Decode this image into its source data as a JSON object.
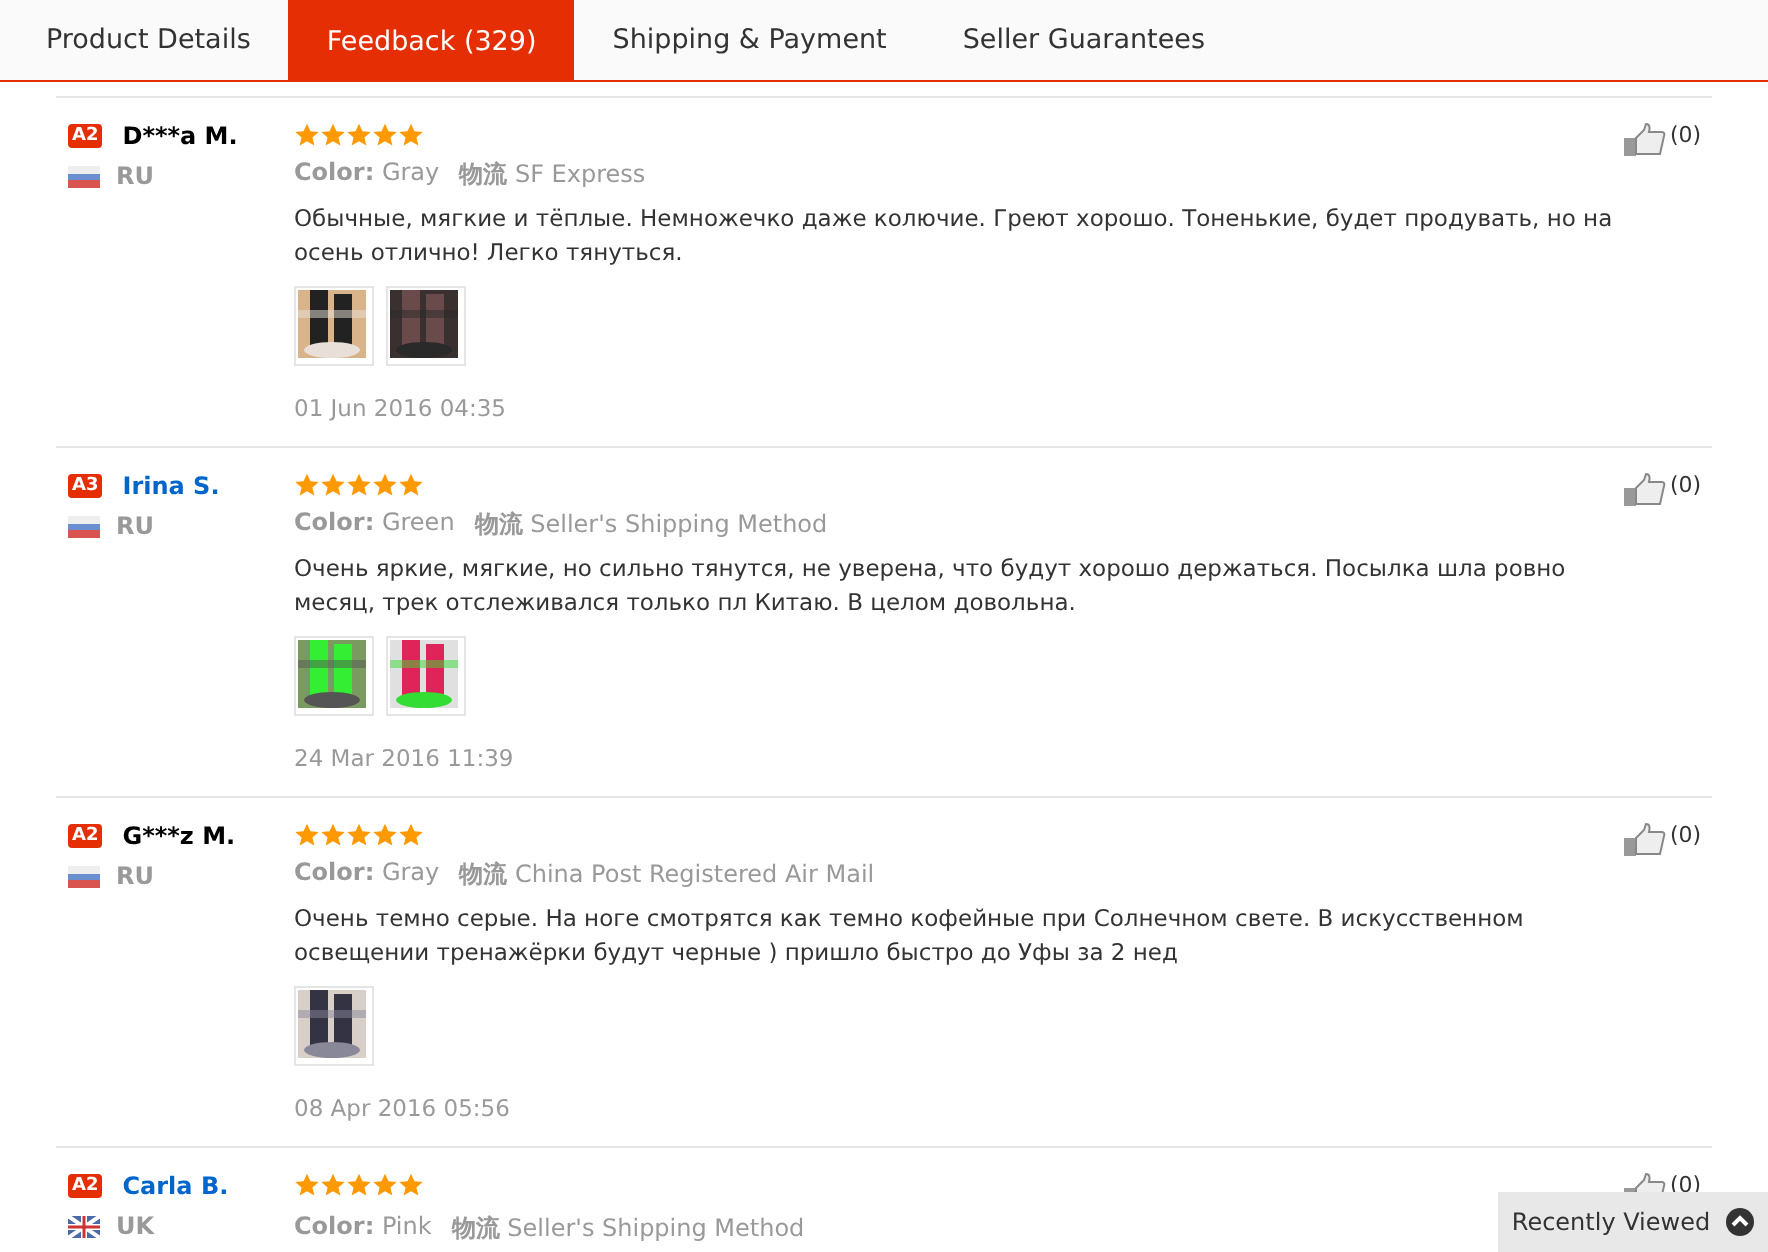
{
  "tabs": [
    {
      "label": "Product Details",
      "selected": false
    },
    {
      "label": "Feedback (329)",
      "selected": true
    },
    {
      "label": "Shipping & Payment",
      "selected": false
    },
    {
      "label": "Seller Guarantees",
      "selected": false
    }
  ],
  "reviews": [
    {
      "level_badge": "A2",
      "name": "D***a M.",
      "highlighted": false,
      "flag": {
        "kind": "tricolor"
      },
      "country": "RU",
      "stars": 5,
      "color_label": "Color:",
      "color_value": "Gray",
      "shipping_label": "物流",
      "shipping_value": "SF Express",
      "text": "Обычные, мягкие и тёплые. Немножечко даже колючие. Греют хорошо. Тоненькие, будет продувать, но на осень отлично! Легко тянуться.",
      "photos": [
        {
          "kind": "picture"
        },
        {
          "kind": "picture"
        }
      ],
      "date": "01 Jun 2016 04:35",
      "likes": "(0)"
    },
    {
      "level_badge": "A3",
      "name": "Irina S.",
      "highlighted": true,
      "flag": {
        "kind": "tricolor"
      },
      "country": "RU",
      "stars": 5,
      "color_label": "Color:",
      "color_value": "Green",
      "shipping_label": "物流",
      "shipping_value": "Seller's Shipping Method",
      "text": "Очень яркие, мягкие, но сильно тянутся, не уверена, что будут хорошо держаться. Посылка шла ровно месяц, трек отслеживался только пл Китаю. В целом довольна.",
      "photos": [
        {
          "kind": "picture"
        },
        {
          "kind": "picture"
        }
      ],
      "date": "24 Mar 2016 11:39",
      "likes": "(0)"
    },
    {
      "level_badge": "A2",
      "name": "G***z M.",
      "highlighted": false,
      "flag": {
        "kind": "tricolor"
      },
      "country": "RU",
      "stars": 5,
      "color_label": "Color:",
      "color_value": "Gray",
      "shipping_label": "物流",
      "shipping_value": "China Post Registered Air Mail",
      "text": "Очень темно серые. На ноге смотрятся как темно кофейные при Солнечном свете. В искусственном освещении тренажёрки будут черные ) пришло быстро до Уфы за 2 нед",
      "photos": [
        {
          "kind": "picture"
        }
      ],
      "date": "08 Apr 2016 05:56",
      "likes": "(0)"
    },
    {
      "level_badge": "A2",
      "name": "Carla B.",
      "highlighted": true,
      "flag": {
        "kind": "union"
      },
      "country": "UK",
      "stars": 5,
      "color_label": "Color:",
      "color_value": "Pink",
      "shipping_label": "物流",
      "shipping_value": "Seller's Shipping Method",
      "likes": "(0)"
    }
  ],
  "recently_viewed": {
    "label": "Recently Viewed"
  }
}
